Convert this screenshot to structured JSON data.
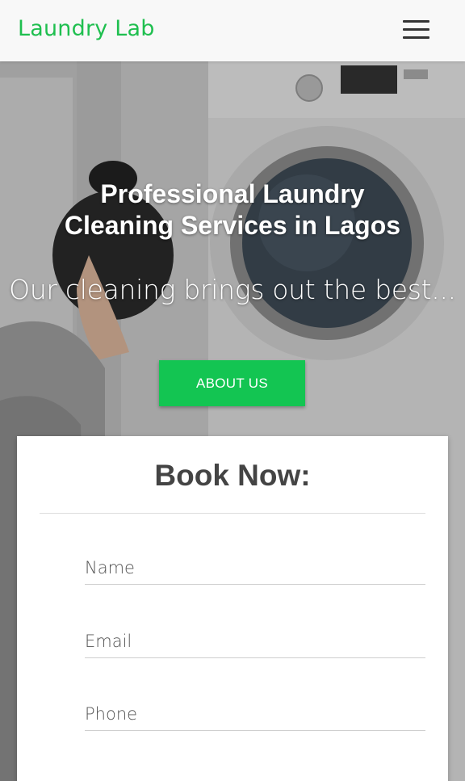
{
  "navbar": {
    "brand": "Laundry Lab",
    "menu_icon": "hamburger-menu-icon"
  },
  "hero": {
    "title_line1": "Professional Laundry",
    "title_line2": "Cleaning Services in Lagos",
    "subtitle": "Our cleaning brings out the best...",
    "about_button": "ABOUT US"
  },
  "booking": {
    "title": "Book Now:",
    "fields": [
      {
        "placeholder": "Name"
      },
      {
        "placeholder": "Email"
      },
      {
        "placeholder": "Phone"
      }
    ]
  },
  "colors": {
    "brand_green": "#1fbf4f",
    "button_green": "#13c552"
  }
}
